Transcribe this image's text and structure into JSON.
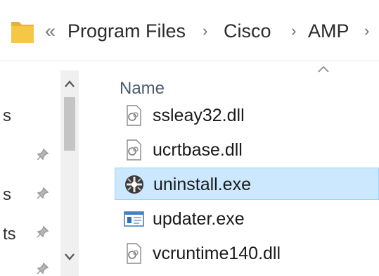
{
  "breadcrumb": {
    "overflow": "«",
    "items": [
      "Program Files",
      "Cisco",
      "AMP"
    ],
    "separator": "›"
  },
  "navigation": {
    "labels": [
      "s",
      "s",
      "ts"
    ]
  },
  "file_list": {
    "column_header": "Name",
    "sort": "ascending",
    "files": [
      {
        "name": "ssleay32.dll",
        "type": "dll"
      },
      {
        "name": "ucrtbase.dll",
        "type": "dll"
      },
      {
        "name": "uninstall.exe",
        "type": "exe-uninstaller",
        "selected": true
      },
      {
        "name": "updater.exe",
        "type": "exe-window"
      },
      {
        "name": "vcruntime140.dll",
        "type": "dll"
      }
    ]
  },
  "colors": {
    "selection_bg": "#cce8ff",
    "selection_border": "#99d1ff",
    "folder": "#f6c744"
  }
}
